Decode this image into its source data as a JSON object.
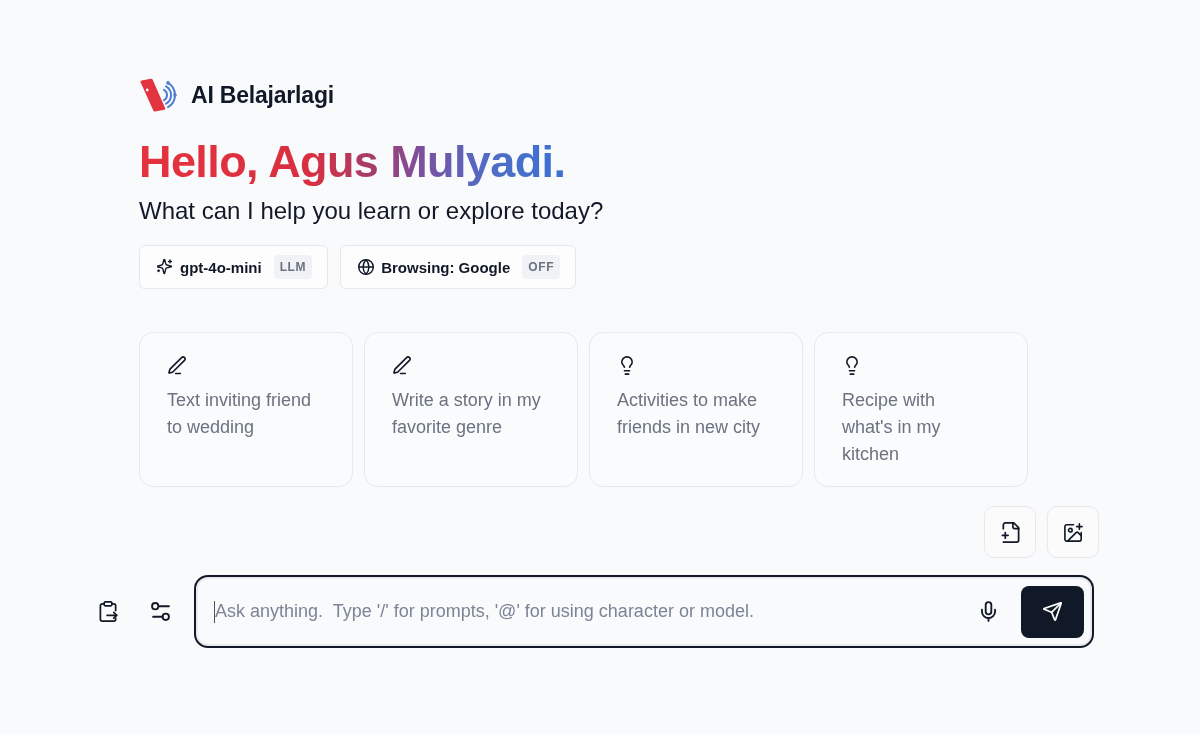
{
  "brand": {
    "name": "AI Belajarlagi"
  },
  "greeting": {
    "title": "Hello, Agus Mulyadi.",
    "subtitle": "What can I help you learn or explore today?"
  },
  "selectors": [
    {
      "kind": "model",
      "label": "gpt-4o-mini",
      "badge": "LLM"
    },
    {
      "kind": "browsing",
      "label": "Browsing: Google",
      "badge": "OFF"
    }
  ],
  "suggestions": [
    {
      "kind": "write",
      "text": "Text inviting friend\nto wedding"
    },
    {
      "kind": "write",
      "text": "Write a story in my\nfavorite genre"
    },
    {
      "kind": "idea",
      "text": "Activities to make\nfriends in new city"
    },
    {
      "kind": "idea",
      "text": "Recipe with\nwhat's in my\nkitchen"
    }
  ],
  "composer": {
    "placeholder": "Ask anything.  Type '/' for prompts, '@' for using character or model."
  }
}
